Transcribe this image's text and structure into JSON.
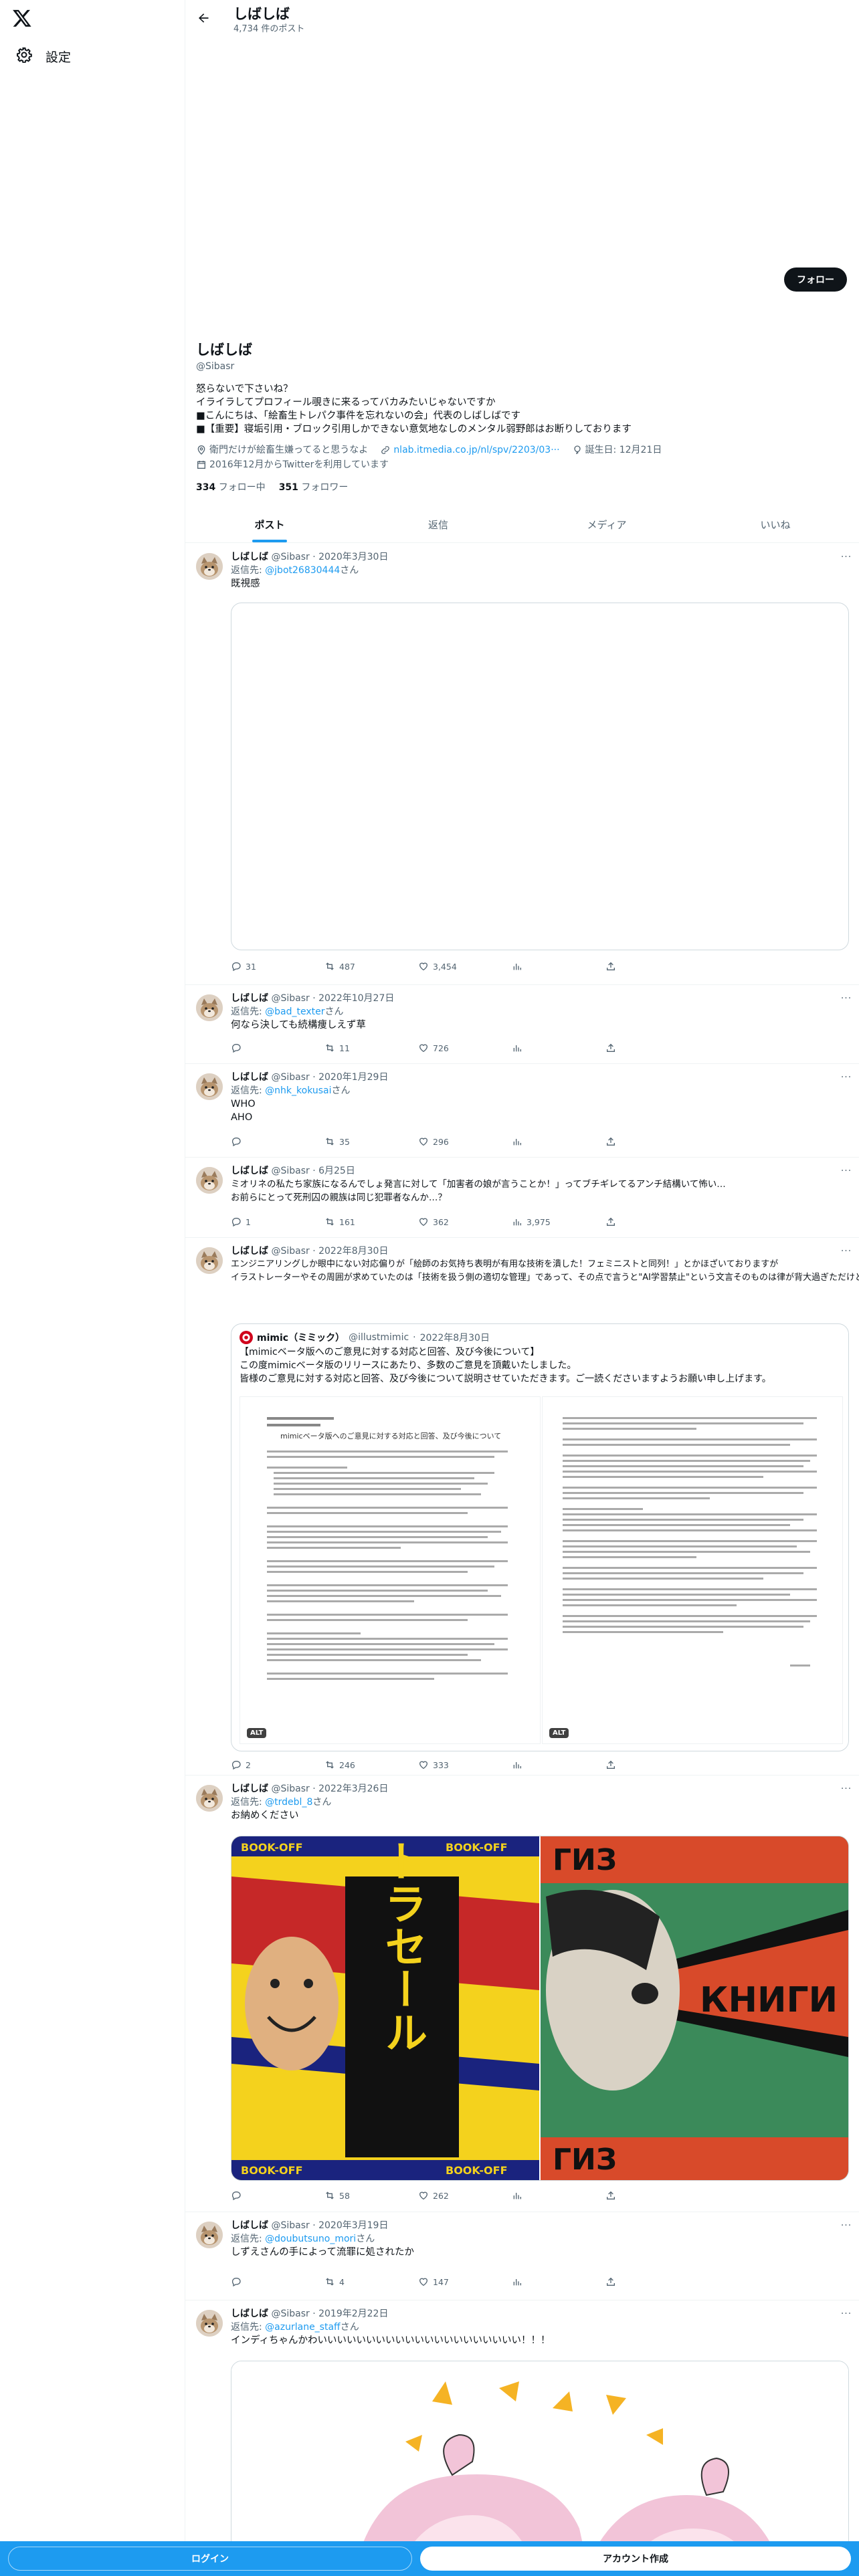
{
  "nav": {
    "settings_label": "設定"
  },
  "header": {
    "name": "しばしば",
    "post_count": "4,734 件のポスト"
  },
  "profile": {
    "follow_label": "フォロー",
    "name": "しばしば",
    "handle": "@Sibasr",
    "bio": [
      "怒らないで下さいね？",
      "イライラしてプロフィール覗きに来るってバカみたいじゃないですか",
      "■こんにちは、「絵畜生トレパク事件を忘れないの会」代表のしばしばです",
      "■【重要】寝垢引用・ブロック引用しかできない意気地なしのメンタル弱野郎はお断りしております"
    ],
    "location": "衛門だけが絵畜生嫌ってると思うなよ",
    "link": "nlab.itmedia.co.jp/nl/spv/2203/03···",
    "birthday": "誕生日: 12月21日",
    "joined": "2016年12月からTwitterを利用しています",
    "following_count": "334",
    "following_label": "フォロー中",
    "followers_count": "351",
    "followers_label": "フォロワー"
  },
  "tabs": [
    "ポスト",
    "返信",
    "メディア",
    "いいね"
  ],
  "tweets": [
    {
      "name": "しばしば",
      "handle": "@Sibasr",
      "date": "2020年3月30日",
      "reply_prefix": "返信先: ",
      "reply_to": "@jbot26830444",
      "reply_suffix": "さん",
      "lines": [
        "既視感"
      ],
      "replies": "31",
      "retweets": "487",
      "likes": "3,454",
      "views": ""
    },
    {
      "name": "しばしば",
      "handle": "@Sibasr",
      "date": "2022年10月27日",
      "reply_prefix": "返信先: ",
      "reply_to": "@bad_texter",
      "reply_suffix": "さん",
      "lines": [
        "何なら決しても続構痩しえず草"
      ],
      "replies": "",
      "retweets": "11",
      "likes": "726",
      "views": ""
    },
    {
      "name": "しばしば",
      "handle": "@Sibasr",
      "date": "2020年1月29日",
      "reply_prefix": "返信先: ",
      "reply_to": "@nhk_kokusai",
      "reply_suffix": "さん",
      "lines": [
        "WHO",
        "AHO"
      ],
      "replies": "",
      "retweets": "35",
      "likes": "296",
      "views": ""
    },
    {
      "name": "しばしば",
      "handle": "@Sibasr",
      "date": "6月25日",
      "reply_prefix": "",
      "reply_to": "",
      "reply_suffix": "",
      "lines": [
        "ミオリネの私たち家族になるんでしょ発言に対して「加害者の娘が言うことか！」ってブチギレてるアンチ結構いて怖い…",
        "お前らにとって死刑囚の親族は同じ犯罪者なんか…？"
      ],
      "replies": "1",
      "retweets": "161",
      "likes": "362",
      "views": "3,975"
    },
    {
      "name": "しばしば",
      "handle": "@Sibasr",
      "date": "2022年8月30日",
      "reply_prefix": "",
      "reply_to": "",
      "reply_suffix": "",
      "lines": [
        "エンジニアリングしか眼中にない対応偏りが「絵師のお気持ち表明が有用な技術を潰した！フェミニストと同列！」とかほざいておりますが",
        "イラストレーターやその周囲が求めていたのは「技術を扱う側の適切な管理」であって、その点で言うと\"AI学習禁止\"という文言そのものは律が背大過ぎただけど→"
      ],
      "replies": "2",
      "retweets": "246",
      "likes": "333",
      "views": ""
    },
    {
      "name": "しばしば",
      "handle": "@Sibasr",
      "date": "2022年3月26日",
      "reply_prefix": "返信先: ",
      "reply_to": "@trdebl_8",
      "reply_suffix": "さん",
      "lines": [
        "お納めください"
      ],
      "replies": "",
      "retweets": "58",
      "likes": "262",
      "views": ""
    },
    {
      "name": "しばしば",
      "handle": "@Sibasr",
      "date": "2020年3月19日",
      "reply_prefix": "返信先: ",
      "reply_to": "@doubutsuno_mori",
      "reply_suffix": "さん",
      "lines": [
        "しずえさんの手によって流罪に処されたか"
      ],
      "replies": "",
      "retweets": "4",
      "likes": "147",
      "views": ""
    },
    {
      "name": "しばしば",
      "handle": "@Sibasr",
      "date": "2019年2月22日",
      "reply_prefix": "返信先: ",
      "reply_to": "@azurlane_staff",
      "reply_suffix": "さん",
      "lines": [
        "インディちゃんかわいいいいいいいいいいいいいいいいいいいいい！！！"
      ],
      "replies": "",
      "retweets": "",
      "likes": "",
      "views": ""
    }
  ],
  "quote": {
    "name": "mimic（ミミック）",
    "handle": "@illustmimic",
    "date": "2022年8月30日",
    "lines": [
      "【mimicベータ版へのご意見に対する対応と回答、及び今後について】",
      "この度mimicベータ版のリリースにあたり、多数のご意見を頂戴いたしました。",
      "皆様のご意見に対する対応と回答、及び今後について説明させていただきます。ご一読くださいますようお願い申し上げます。"
    ],
    "doc_title": "mimicベータ版へのご意見に対する対応と回答、及び今後について",
    "alt": "ALT"
  },
  "poster": {
    "left_top": "BOOK-OFF",
    "left_text": "ウルトラセール",
    "right_top": "ГИЗ",
    "right_text": "КНИГИ"
  },
  "bottom": {
    "login": "ログイン",
    "signup": "アカウント作成"
  }
}
